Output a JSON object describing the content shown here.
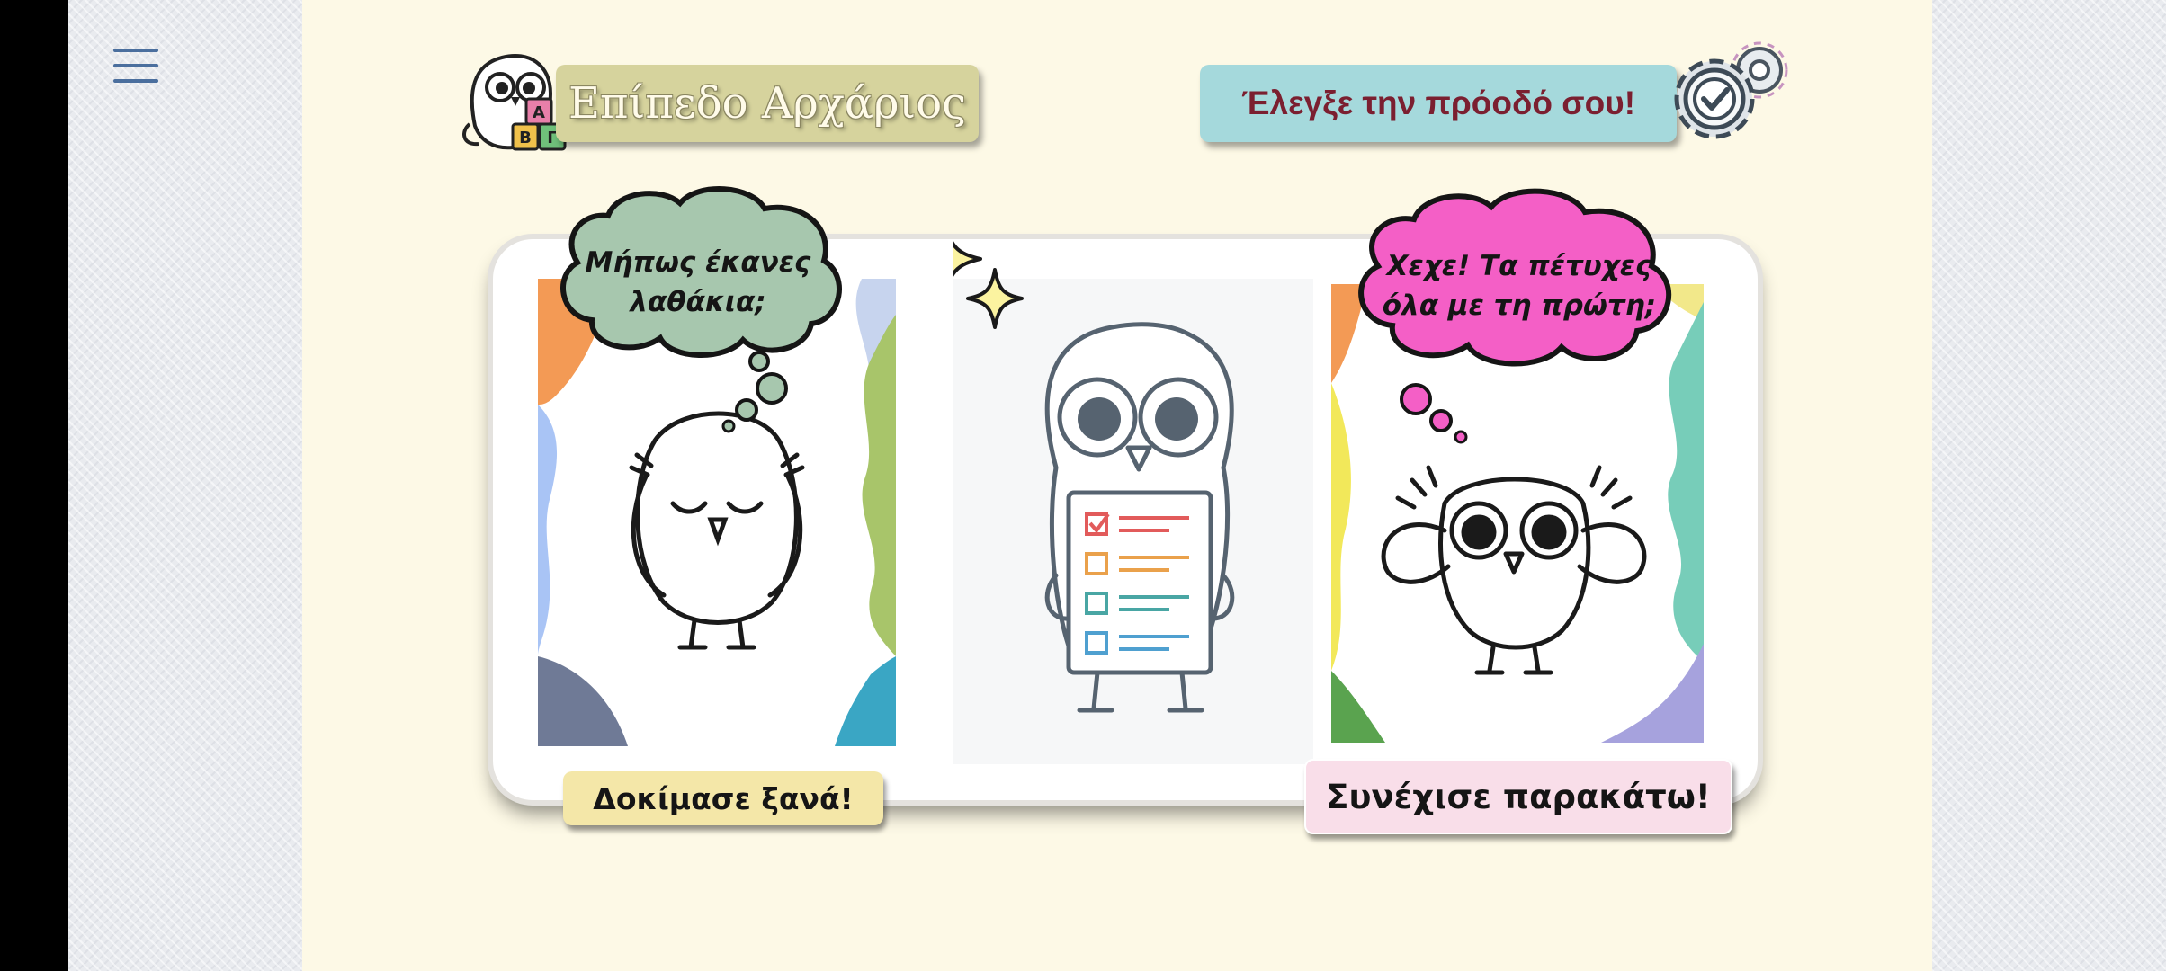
{
  "header": {
    "level_title": "Επίπεδο Αρχάριος",
    "progress_button_label": "Έλεγξε την πρόοδό σου!",
    "badge_blocks": [
      "A",
      "B",
      "Γ"
    ]
  },
  "panel": {
    "left_bubble_lines": [
      "Μήπως έκανες",
      "λαθάκια;"
    ],
    "right_bubble_lines": [
      "Χεχε! Τα πέτυχες",
      "όλα με τη πρώτη;"
    ],
    "retry_button_label": "Δοκίμασε ξανά!",
    "continue_button_label": "Συνέχισε παρακάτω!"
  },
  "colors": {
    "page_bg": "#fdf9e6",
    "title_plate": "#d6d39d",
    "progress_plate": "#a5d9dc",
    "progress_text": "#7b1f30",
    "left_bubble": "#a7c7ae",
    "right_bubble": "#f45fc6",
    "retry_button": "#f4e7a8",
    "continue_button": "#f9dee9",
    "menu_icon": "#4b6f9e"
  },
  "icons": {
    "menu": "hamburger-menu-icon",
    "badge": "owl-abc-blocks-icon",
    "progress": "gear-check-icon",
    "sparkles": "sparkle-icon"
  }
}
